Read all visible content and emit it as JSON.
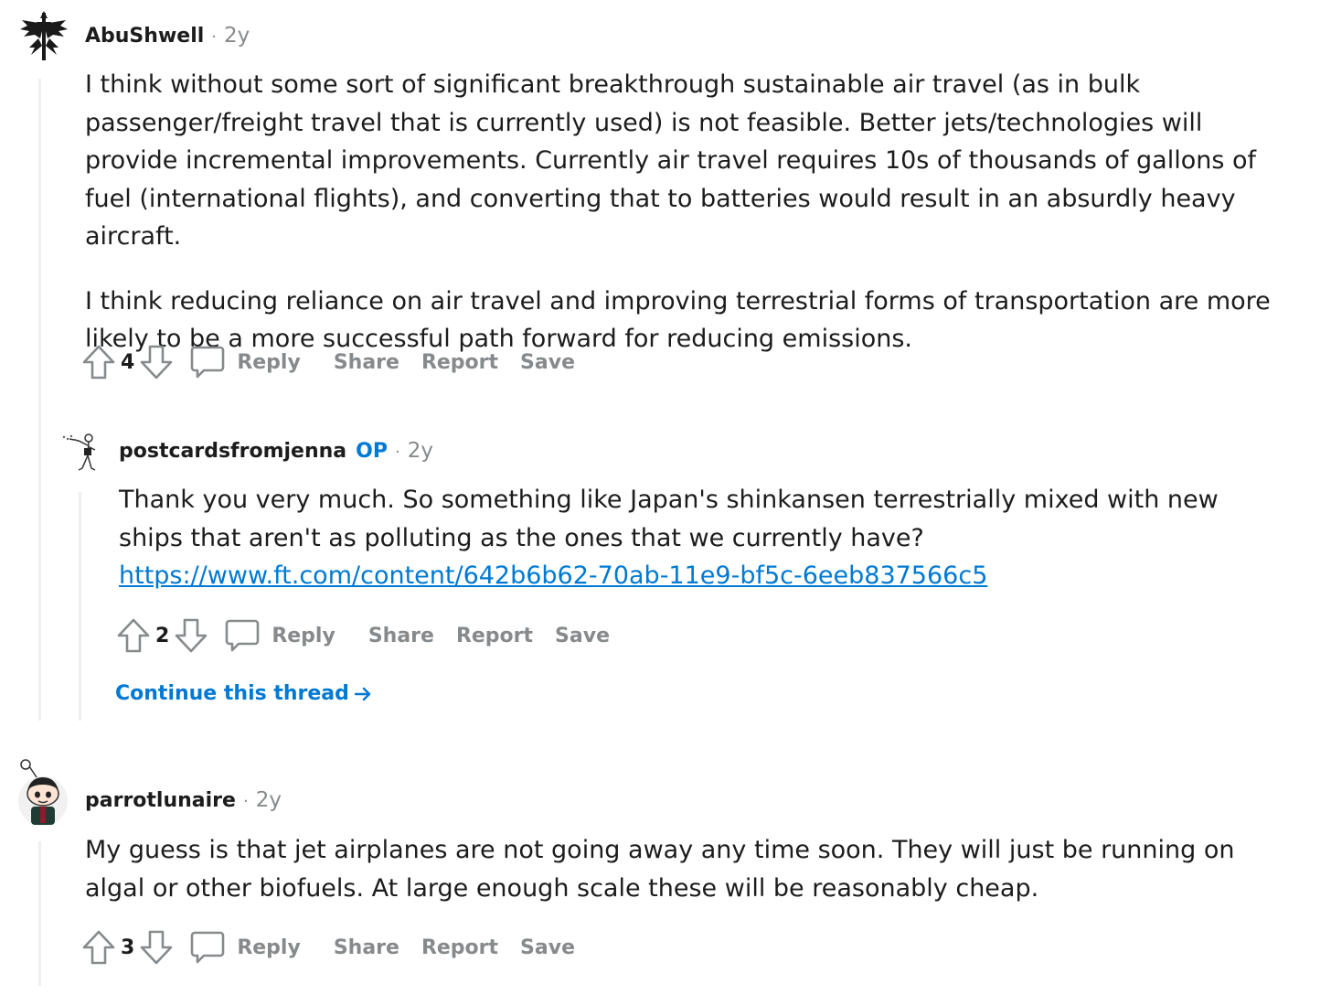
{
  "comments": [
    {
      "author": "AbuShwell",
      "age": "2y",
      "paragraphs": [
        "I think without some sort of significant breakthrough sustainable air travel (as in bulk passenger/freight travel that is currently used) is not feasible. Better jets/technologies will provide incremental improvements. Currently air travel requires 10s of thousands of gallons of fuel (international flights), and converting that to batteries would result in an absurdly heavy aircraft.",
        "I think reducing reliance on air travel and improving terrestrial forms of transportation are more likely to be a more successful path forward for reducing emissions."
      ],
      "score": "4"
    },
    {
      "author": "postcardsfromjenna",
      "op_badge": "OP",
      "age": "2y",
      "text": "Thank you very much. So something like Japan's shinkansen terrestrially mixed with new ships that aren't as polluting as the ones that we currently have?",
      "link": "https://www.ft.com/content/642b6b62-70ab-11e9-bf5c-6eeb837566c5",
      "score": "2",
      "continue_label": "Continue this thread"
    },
    {
      "author": "parrotlunaire",
      "age": "2y",
      "text": "My guess is that jet airplanes are not going away any time soon. They will just be running on algal or other biofuels. At large enough scale these will be reasonably cheap.",
      "score": "3"
    }
  ],
  "actions": {
    "reply": "Reply",
    "share": "Share",
    "report": "Report",
    "save": "Save"
  },
  "separator": "·",
  "colors": {
    "text": "#1c1c1c",
    "muted": "#878a8c",
    "accent": "#0079d3",
    "thread_line": "#edeff1"
  },
  "icons": [
    "upvote-icon",
    "downvote-icon",
    "comment-icon",
    "arrow-right-icon"
  ]
}
